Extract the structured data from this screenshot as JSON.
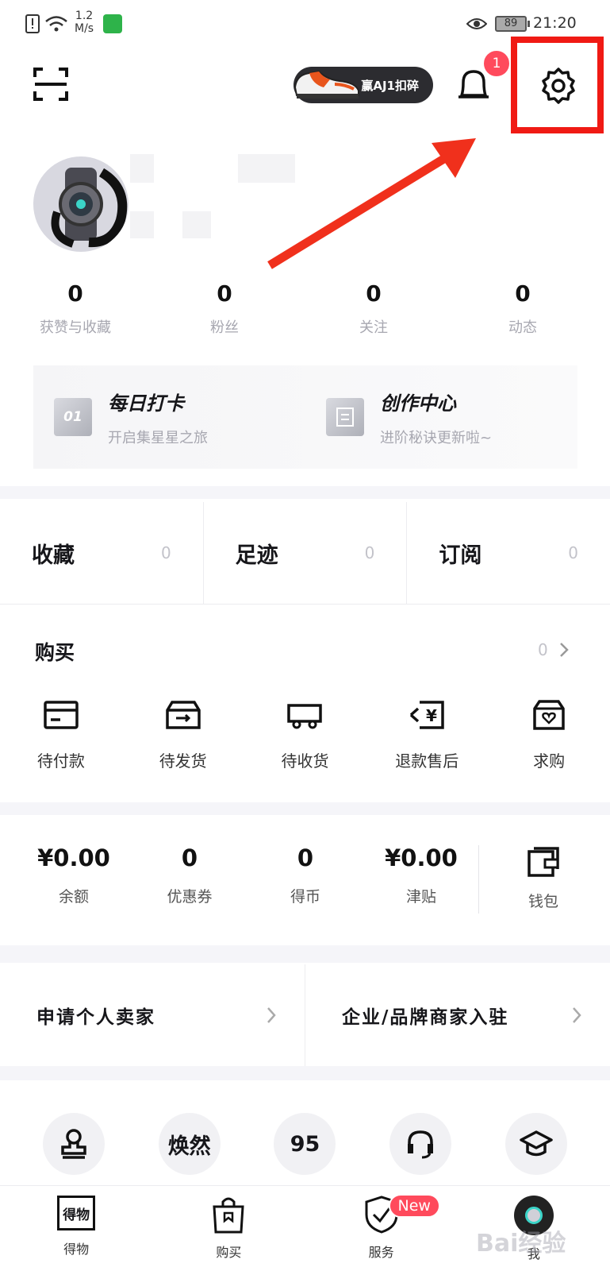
{
  "status_bar": {
    "network_speed_value": "1.2",
    "network_speed_unit": "M/s",
    "battery": "89",
    "time": "21:20"
  },
  "top_bar": {
    "promo_label": "赢AJ1扣碎",
    "notification_count": "1"
  },
  "stats": [
    {
      "value": "0",
      "label": "获赞与收藏"
    },
    {
      "value": "0",
      "label": "粉丝"
    },
    {
      "value": "0",
      "label": "关注"
    },
    {
      "value": "0",
      "label": "动态"
    }
  ],
  "cards": [
    {
      "icon_text": "01",
      "title": "每日打卡",
      "subtitle": "开启集星星之旅"
    },
    {
      "icon_text": "",
      "title": "创作中心",
      "subtitle": "进阶秘诀更新啦~"
    }
  ],
  "counts": [
    {
      "label": "收藏",
      "value": "0"
    },
    {
      "label": "足迹",
      "value": "0"
    },
    {
      "label": "订阅",
      "value": "0"
    }
  ],
  "purchase": {
    "title": "购买",
    "count": "0",
    "items": [
      {
        "label": "待付款",
        "icon": "card-icon"
      },
      {
        "label": "待发货",
        "icon": "box-icon"
      },
      {
        "label": "待收货",
        "icon": "truck-icon"
      },
      {
        "label": "退款售后",
        "icon": "refund-icon"
      },
      {
        "label": "求购",
        "icon": "wish-bag-icon"
      }
    ]
  },
  "wallet": {
    "items": [
      {
        "value": "¥0.00",
        "label": "余额"
      },
      {
        "value": "0",
        "label": "优惠券"
      },
      {
        "value": "0",
        "label": "得币"
      },
      {
        "value": "¥0.00",
        "label": "津贴"
      }
    ],
    "wallet_label": "钱包"
  },
  "merchant": [
    {
      "label": "申请个人卖家"
    },
    {
      "label": "企业/品牌商家入驻"
    }
  ],
  "services": [
    {
      "icon": "stamp-icon",
      "text": ""
    },
    {
      "icon": "text-badge",
      "text": "焕然"
    },
    {
      "icon": "text-badge",
      "text": "95"
    },
    {
      "icon": "headset-icon",
      "text": ""
    },
    {
      "icon": "graduation-cap-icon",
      "text": ""
    }
  ],
  "tabs": [
    {
      "label": "得物",
      "logo_text": "得物"
    },
    {
      "label": "购买"
    },
    {
      "label": "服务",
      "badge": "New"
    },
    {
      "label": "我"
    }
  ],
  "watermark": "Bai经验",
  "colors": {
    "accent_red": "#ff4a5c",
    "highlight_red": "#f01a14",
    "muted_text": "#a7a7b0"
  }
}
